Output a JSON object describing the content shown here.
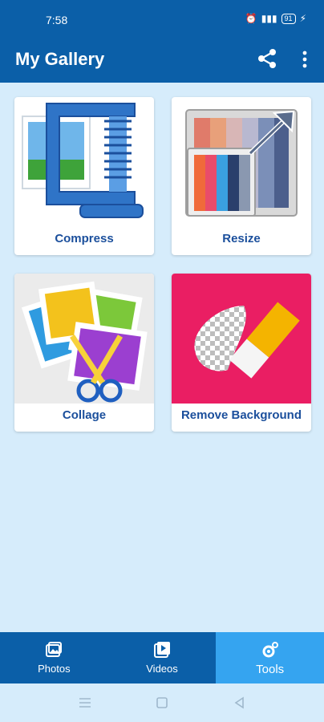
{
  "status": {
    "time": "7:58",
    "battery": "91"
  },
  "appbar": {
    "title": "My Gallery"
  },
  "tools": [
    {
      "label": "Compress"
    },
    {
      "label": "Resize"
    },
    {
      "label": "Collage"
    },
    {
      "label": "Remove Background"
    }
  ],
  "nav": {
    "items": [
      {
        "label": "Photos"
      },
      {
        "label": "Videos"
      },
      {
        "label": "Tools"
      }
    ],
    "active": "Tools"
  },
  "colors": {
    "primary": "#0b5fa8",
    "active_tab": "#35a4f0",
    "background": "#d6ecfb",
    "label": "#1b4f9c"
  }
}
